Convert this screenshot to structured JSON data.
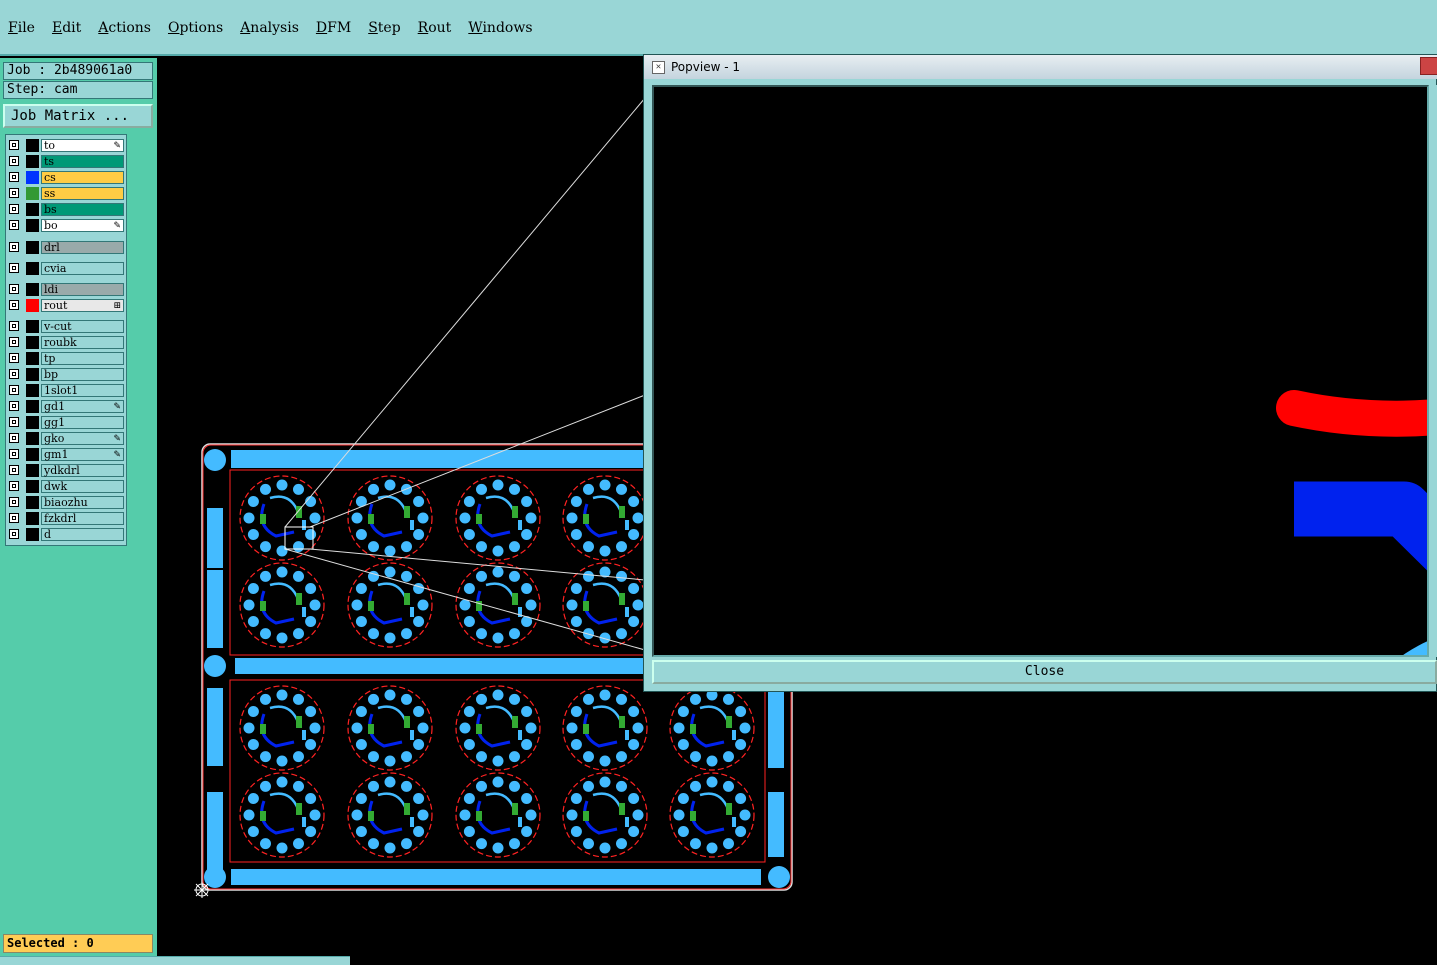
{
  "menu": [
    "File",
    "Edit",
    "Actions",
    "Options",
    "Analysis",
    "DFM",
    "Step",
    "Rout",
    "Windows"
  ],
  "job": {
    "label": "Job : 2b489061a0",
    "step": "Step: cam"
  },
  "matrix_button": "Job Matrix ...",
  "layers": [
    {
      "name": "to",
      "bg": "#ffffff",
      "sw": "#000000",
      "mark": "✎"
    },
    {
      "name": "ts",
      "bg": "#009977",
      "sw": "#000000",
      "mark": ""
    },
    {
      "name": "cs",
      "bg": "#ffcc44",
      "sw": "#0033ff",
      "mark": ""
    },
    {
      "name": "ss",
      "bg": "#ffcc44",
      "sw": "#339933",
      "mark": ""
    },
    {
      "name": "bs",
      "bg": "#009977",
      "sw": "#000000",
      "mark": ""
    },
    {
      "name": "bo",
      "bg": "#ffffff",
      "sw": "#000000",
      "mark": "✎"
    },
    {
      "name": "drl",
      "bg": "#99aaaa",
      "sw": "#000000",
      "mark": ""
    },
    {
      "name": "cvia",
      "bg": "#99d6d6",
      "sw": "#000000",
      "mark": ""
    },
    {
      "name": "ldi",
      "bg": "#99aaaa",
      "sw": "#000000",
      "mark": ""
    },
    {
      "name": "rout",
      "bg": "#e8e8e8",
      "sw": "#ff0000",
      "mark": "⊞"
    },
    {
      "name": "v-cut",
      "bg": "#99d6d6",
      "sw": "#000000",
      "mark": ""
    },
    {
      "name": "roubk",
      "bg": "#99d6d6",
      "sw": "#000000",
      "mark": ""
    },
    {
      "name": "tp",
      "bg": "#99d6d6",
      "sw": "#000000",
      "mark": ""
    },
    {
      "name": "bp",
      "bg": "#99d6d6",
      "sw": "#000000",
      "mark": ""
    },
    {
      "name": "1slot1",
      "bg": "#99d6d6",
      "sw": "#000000",
      "mark": ""
    },
    {
      "name": "gd1",
      "bg": "#99d6d6",
      "sw": "#000000",
      "mark": "✎"
    },
    {
      "name": "gg1",
      "bg": "#99d6d6",
      "sw": "#000000",
      "mark": ""
    },
    {
      "name": "gko",
      "bg": "#99d6d6",
      "sw": "#000000",
      "mark": "✎"
    },
    {
      "name": "gm1",
      "bg": "#99d6d6",
      "sw": "#000000",
      "mark": "✎"
    },
    {
      "name": "ydkdrl",
      "bg": "#99d6d6",
      "sw": "#000000",
      "mark": ""
    },
    {
      "name": "dwk",
      "bg": "#99d6d6",
      "sw": "#000000",
      "mark": ""
    },
    {
      "name": "biaozhu",
      "bg": "#99d6d6",
      "sw": "#000000",
      "mark": ""
    },
    {
      "name": "fzkdrl",
      "bg": "#99d6d6",
      "sw": "#000000",
      "mark": ""
    },
    {
      "name": "d",
      "bg": "#99d6d6",
      "sw": "#000000",
      "mark": ""
    }
  ],
  "selected": "Selected : 0",
  "popview": {
    "title": "Popview - 1",
    "close_label": "Close"
  },
  "colors": {
    "pad": "#44bbff",
    "route": "#ff0000",
    "trace": "#0022ee",
    "outline": "#ffffff",
    "highlight": "#ffff00"
  }
}
